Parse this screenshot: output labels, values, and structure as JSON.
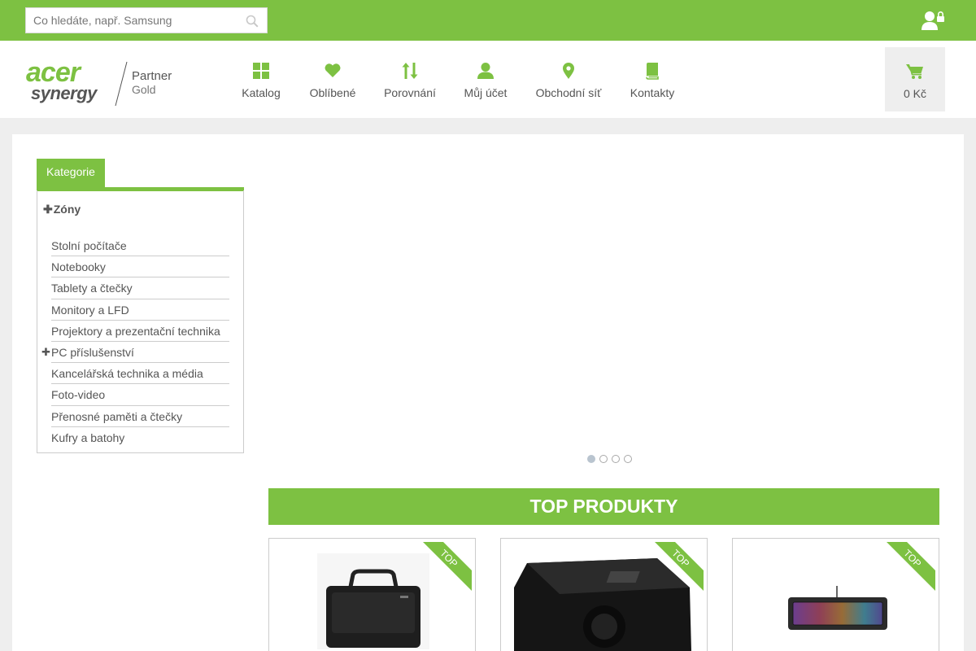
{
  "search": {
    "placeholder": "Co hledáte, např. Samsung"
  },
  "logo": {
    "brand": "acer",
    "sub": "synergy",
    "partner": "Partner",
    "level": "Gold"
  },
  "nav": [
    {
      "label": "Katalog",
      "icon": "grid-icon"
    },
    {
      "label": "Oblíbené",
      "icon": "heart-icon"
    },
    {
      "label": "Porovnání",
      "icon": "sort-arrows-icon"
    },
    {
      "label": "Můj účet",
      "icon": "user-icon"
    },
    {
      "label": "Obchodní síť",
      "icon": "map-pin-icon"
    },
    {
      "label": "Kontakty",
      "icon": "book-icon"
    }
  ],
  "cart": {
    "label": "0 Kč",
    "icon": "cart-icon"
  },
  "sidebar": {
    "tab": "Kategorie",
    "zones": "Zóny",
    "items": [
      {
        "label": "Stolní počítače"
      },
      {
        "label": "Notebooky"
      },
      {
        "label": "Tablety a čtečky"
      },
      {
        "label": "Monitory a LFD"
      },
      {
        "label": "Projektory a prezentační technika"
      },
      {
        "label": "PC příslušenství",
        "expandable": true
      },
      {
        "label": "Kancelářská technika a média"
      },
      {
        "label": "Foto-video"
      },
      {
        "label": "Přenosné paměti a čtečky"
      },
      {
        "label": "Kufry a batohy"
      }
    ]
  },
  "slider": {
    "dots": 4,
    "active": 1
  },
  "top_products": {
    "title": "TOP PRODUKTY",
    "badge": "TOP",
    "items": [
      {
        "image": "laptop-bag-image"
      },
      {
        "image": "projector-image"
      },
      {
        "image": "keyboard-image"
      }
    ]
  },
  "colors": {
    "accent": "#7dc142",
    "text": "#555555",
    "background": "#eeeeee"
  }
}
